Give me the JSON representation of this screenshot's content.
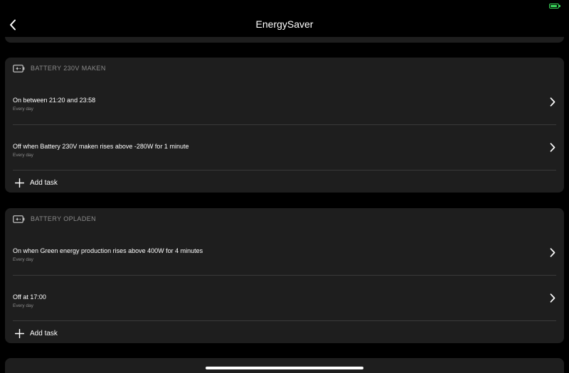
{
  "header": {
    "title": "EnergySaver"
  },
  "sections": [
    {
      "device": "BATTERY 230V MAKEN",
      "tasks": [
        {
          "title": "On between 21:20 and 23:58",
          "subtitle": "Every day"
        },
        {
          "title": "Off when Battery 230V maken rises above -280W for 1 minute",
          "subtitle": "Every day"
        }
      ],
      "add_label": "Add task"
    },
    {
      "device": "BATTERY OPLADEN",
      "tasks": [
        {
          "title": "On when Green energy production rises above 400W for 4 minutes",
          "subtitle": "Every day"
        },
        {
          "title": "Off at 17:00",
          "subtitle": "Every day"
        }
      ],
      "add_label": "Add task"
    }
  ],
  "icons": {
    "back": "chevron-left-icon",
    "chevron": "chevron-right-icon",
    "device": "battery-plug-icon",
    "add": "plus-icon",
    "status": "battery-charging-icon"
  },
  "colors": {
    "background": "#000000",
    "card": "#1e1e1e",
    "divider": "#3a3a3a",
    "muted_text": "#8c8c8c",
    "status_green": "#3ad55a"
  }
}
